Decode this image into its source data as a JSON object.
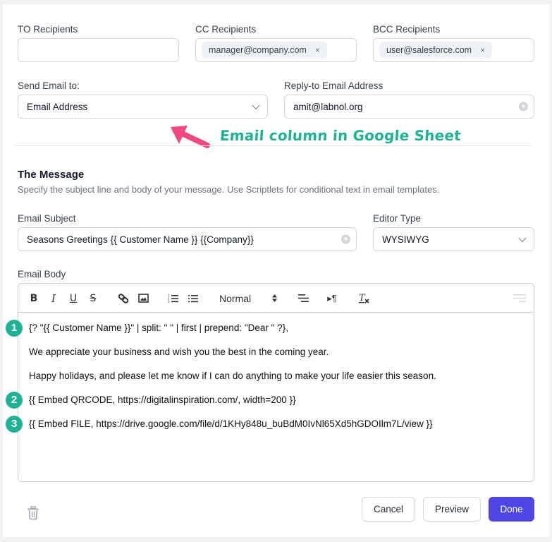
{
  "recipients": {
    "to": {
      "label": "TO Recipients",
      "chips": []
    },
    "cc": {
      "label": "CC Recipients",
      "chips": [
        "manager@company.com"
      ]
    },
    "bcc": {
      "label": "BCC Recipients",
      "chips": [
        "user@salesforce.com"
      ]
    },
    "chip_remove_icon": "×"
  },
  "send_to": {
    "label": "Send Email to:",
    "value": "Email Address"
  },
  "reply_to": {
    "label": "Reply-to Email Address",
    "value": "amit@labnol.org"
  },
  "annotation": {
    "text": "Email column in Google Sheet",
    "arrow_color": "#f0487f",
    "text_color": "#1db394"
  },
  "message": {
    "title": "The Message",
    "description": "Specify the subject line and body of your message. Use Scriptlets for conditional text in email templates."
  },
  "subject": {
    "label": "Email Subject",
    "value": "Seasons Greetings {{ Customer Name }} {{Company}}"
  },
  "editor_type": {
    "label": "Editor Type",
    "value": "WYSIWYG"
  },
  "body": {
    "label": "Email Body",
    "toolbar": {
      "bold": "B",
      "italic": "I",
      "underline": "U",
      "strike": "S",
      "format_select": "Normal"
    },
    "lines": [
      {
        "badge": "1",
        "text": "{? \"{{ Customer Name }}\" | split: \" \" | first | prepend: \"Dear \" ?},"
      },
      {
        "badge": "",
        "text": "We appreciate your business and wish you the best in the coming year."
      },
      {
        "badge": "",
        "text": "Happy holidays, and please let me know if I can do anything to make your life easier this season."
      },
      {
        "badge": "2",
        "text": "{{ Embed QRCODE, https://digitalinspiration.com/, width=200 }}"
      },
      {
        "badge": "3",
        "text": "{{ Embed FILE, https://drive.google.com/file/d/1KHy848u_buBdM0IvNl65Xd5hGDOIlm7L/view }}"
      }
    ],
    "badge_color": "#1db394"
  },
  "footer": {
    "cancel": "Cancel",
    "preview": "Preview",
    "done": "Done",
    "done_color": "#4f46e5"
  }
}
